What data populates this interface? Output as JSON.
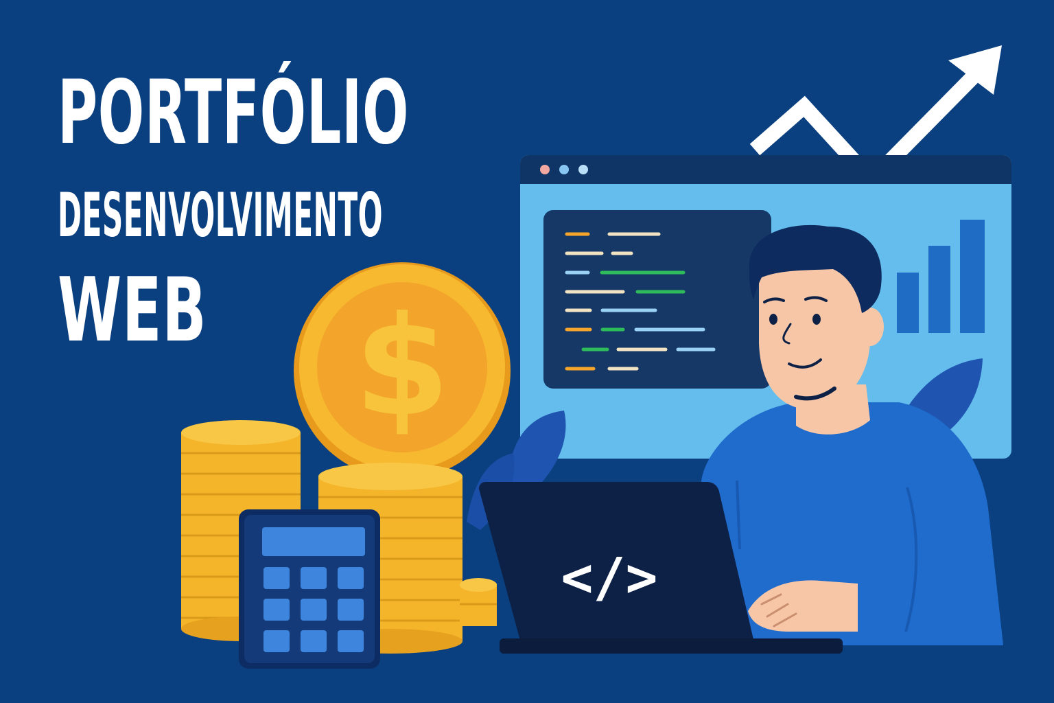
{
  "title": {
    "line1": "PORTFÓLIO",
    "line2": "DESENVOLVIMENTO",
    "line3": "WEB"
  },
  "laptop": {
    "code_symbol": "</>"
  },
  "coin": {
    "symbol": "$"
  },
  "colors": {
    "background": "#0b4080",
    "title_text": "#ffffff",
    "browser_screen": "#64bdec",
    "browser_bar": "#0f3566",
    "code_panel": "#163866",
    "coin_gold": "#f7b92f",
    "shirt_blue": "#1f6ccd",
    "laptop_dark": "#0d2147"
  },
  "icons": [
    "trend-up-arrow-icon",
    "dollar-coin-icon",
    "calculator-icon",
    "laptop-code-icon",
    "bar-chart-icon",
    "code-editor-icon"
  ]
}
